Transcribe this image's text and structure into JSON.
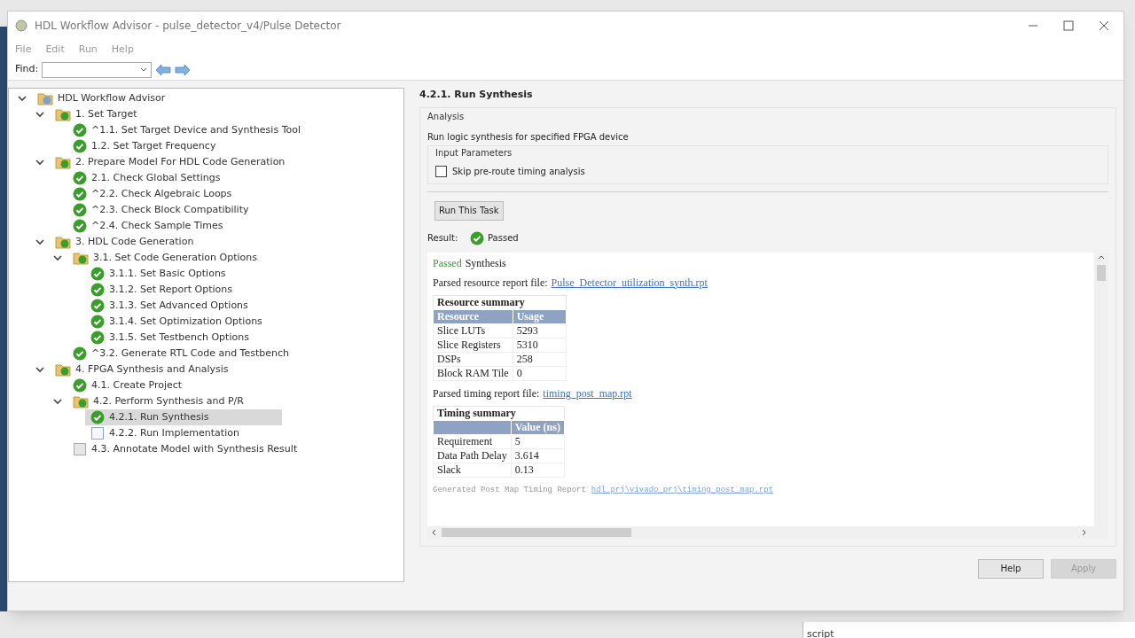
{
  "window": {
    "title": "HDL Workflow Advisor - pulse_detector_v4/Pulse Detector"
  },
  "menu": [
    "File",
    "Edit",
    "Run",
    "Help"
  ],
  "toolbar": {
    "find_label": "Find:"
  },
  "tree": [
    {
      "label": "HDL Workflow Advisor",
      "kind": "advisor",
      "expanded": true,
      "selected": false,
      "children": [
        {
          "label": "1. Set Target",
          "kind": "folder",
          "expanded": true,
          "selected": false,
          "children": [
            {
              "label": "^1.1. Set Target Device and Synthesis Tool",
              "kind": "passed",
              "selected": false
            },
            {
              "label": "1.2. Set Target Frequency",
              "kind": "passed",
              "selected": false
            }
          ]
        },
        {
          "label": "2. Prepare Model For HDL Code Generation",
          "kind": "folder",
          "expanded": true,
          "selected": false,
          "children": [
            {
              "label": "2.1. Check Global Settings",
              "kind": "passed",
              "selected": false
            },
            {
              "label": "^2.2. Check Algebraic Loops",
              "kind": "passed",
              "selected": false
            },
            {
              "label": "^2.3. Check Block Compatibility",
              "kind": "passed",
              "selected": false
            },
            {
              "label": "^2.4. Check Sample Times",
              "kind": "passed",
              "selected": false
            }
          ]
        },
        {
          "label": "3. HDL Code Generation",
          "kind": "folder",
          "expanded": true,
          "selected": false,
          "children": [
            {
              "label": "3.1. Set Code Generation Options",
              "kind": "folder",
              "expanded": true,
              "selected": false,
              "children": [
                {
                  "label": "3.1.1. Set Basic Options",
                  "kind": "passed",
                  "selected": false
                },
                {
                  "label": "3.1.2. Set Report Options",
                  "kind": "passed",
                  "selected": false
                },
                {
                  "label": "3.1.3. Set Advanced Options",
                  "kind": "passed",
                  "selected": false
                },
                {
                  "label": "3.1.4. Set Optimization Options",
                  "kind": "passed",
                  "selected": false
                },
                {
                  "label": "3.1.5. Set Testbench Options",
                  "kind": "passed",
                  "selected": false
                }
              ]
            },
            {
              "label": "^3.2. Generate RTL Code and Testbench",
              "kind": "passed",
              "selected": false
            }
          ]
        },
        {
          "label": "4. FPGA Synthesis and Analysis",
          "kind": "folder",
          "expanded": true,
          "selected": false,
          "children": [
            {
              "label": "4.1. Create Project",
              "kind": "passed",
              "selected": false
            },
            {
              "label": "4.2. Perform Synthesis and P/R",
              "kind": "folder",
              "expanded": true,
              "selected": false,
              "children": [
                {
                  "label": "4.2.1. Run Synthesis",
                  "kind": "passed",
                  "selected": true
                },
                {
                  "label": "4.2.2. Run Implementation",
                  "kind": "task",
                  "selected": false
                }
              ]
            },
            {
              "label": "4.3. Annotate Model with Synthesis Result",
              "kind": "pending",
              "selected": false
            }
          ]
        }
      ]
    }
  ],
  "task": {
    "title": "4.2.1. Run Synthesis",
    "group_title": "Analysis",
    "description": "Run logic synthesis for specified FPGA device",
    "params_title": "Input Parameters",
    "checkbox": {
      "label": "Skip pre-route timing analysis",
      "checked": false
    },
    "run_button": "Run This Task",
    "result_label": "Result:",
    "result": "Passed"
  },
  "report": {
    "status_word": "Passed",
    "status_rest": "Synthesis",
    "resource_line": "Parsed resource report file:",
    "resource_link": "Pulse_Detector_utilization_synth.rpt",
    "resource_table": {
      "title": "Resource summary",
      "columns": [
        "Resource",
        "Usage"
      ],
      "rows": [
        [
          "Slice LUTs",
          "5293"
        ],
        [
          "Slice Registers",
          "5310"
        ],
        [
          "DSPs",
          "258"
        ],
        [
          "Block RAM Tile",
          "0"
        ]
      ]
    },
    "timing_line": "Parsed timing report file:",
    "timing_link": "timing_post_map.rpt",
    "timing_table": {
      "title": "Timing summary",
      "columns": [
        "",
        "Value (ns)"
      ],
      "rows": [
        [
          "Requirement",
          "5"
        ],
        [
          "Data Path Delay",
          "3.614"
        ],
        [
          "Slack",
          "0.13"
        ]
      ]
    },
    "generated_line": "Generated Post Map Timing Report",
    "generated_link": "hdl_prj\\vivado_prj\\timing_post_map.rpt"
  },
  "buttons": [
    {
      "label": "Help",
      "disabled": false
    },
    {
      "label": "Apply",
      "disabled": true
    }
  ],
  "background": {
    "field_text": "script"
  }
}
